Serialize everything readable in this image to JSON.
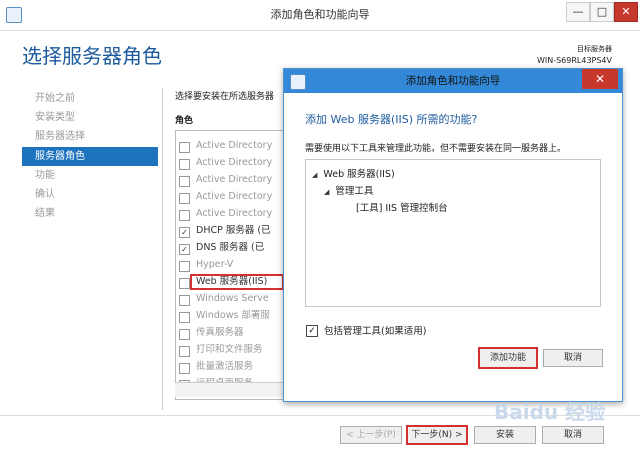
{
  "window": {
    "title": "添加角色和功能向导",
    "min": "—",
    "max": "□",
    "close": "✕"
  },
  "page": {
    "title": "选择服务器角色",
    "target_label": "目标服务器",
    "target_value": "WIN-S69RL43PS4V"
  },
  "nav": {
    "items": [
      "开始之前",
      "安装类型",
      "服务器选择",
      "服务器角色",
      "功能",
      "确认",
      "结果"
    ],
    "active_index": 3
  },
  "roles": {
    "instruction": "选择要安装在所选服务器",
    "column_header": "角色",
    "items": [
      {
        "label": "Active Directory",
        "checked": false
      },
      {
        "label": "Active Directory",
        "checked": false
      },
      {
        "label": "Active Directory",
        "checked": false
      },
      {
        "label": "Active Directory",
        "checked": false
      },
      {
        "label": "Active Directory",
        "checked": false
      },
      {
        "label": "DHCP 服务器 (已",
        "checked": true
      },
      {
        "label": "DNS 服务器 (已",
        "checked": true
      },
      {
        "label": "Hyper-V",
        "checked": false
      },
      {
        "label": "Web 服务器(IIS)",
        "checked": false
      },
      {
        "label": "Windows Serve",
        "checked": false
      },
      {
        "label": "Windows 部署服",
        "checked": false
      },
      {
        "label": "传真服务器",
        "checked": false
      },
      {
        "label": "打印和文件服务",
        "checked": false
      },
      {
        "label": "批量激活服务",
        "checked": false
      },
      {
        "label": "远程桌面服务",
        "checked": false
      }
    ]
  },
  "footer": {
    "prev": "< 上一步(P)",
    "next": "下一步(N) >",
    "install": "安装",
    "cancel": "取消"
  },
  "dialog": {
    "title": "添加角色和功能向导",
    "close": "✕",
    "heading": "添加 Web 服务器(IIS) 所需的功能?",
    "description": "需要使用以下工具来管理此功能，但不需要安装在同一服务器上。",
    "tree": [
      {
        "label": "Web 服务器(IIS)",
        "level": 0,
        "arrow": "◢"
      },
      {
        "label": "管理工具",
        "level": 1,
        "arrow": "◢"
      },
      {
        "label": "[工具] IIS 管理控制台",
        "level": 2,
        "arrow": ""
      }
    ],
    "include_tools_label": "包括管理工具(如果适用)",
    "include_tools_checked": true,
    "add_button": "添加功能",
    "cancel_button": "取消"
  },
  "watermark": "Baidu 经验"
}
